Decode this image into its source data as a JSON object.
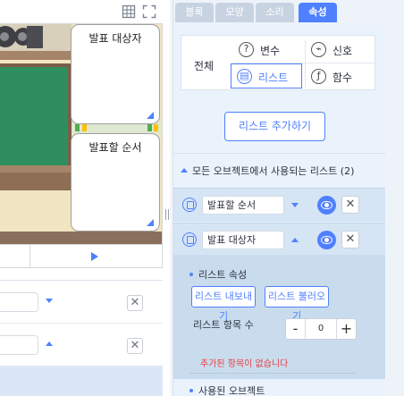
{
  "stage": {
    "toolbar": {
      "grid_icon": "grid-icon",
      "fullscreen_icon": "fullscreen-icon"
    },
    "list_cards": [
      {
        "title": "발표 대상자"
      },
      {
        "title": "발표할 순서"
      }
    ],
    "play_icon": "play-icon"
  },
  "object_panel": {
    "rows": [
      {
        "caret": "down"
      },
      {
        "caret": "up"
      }
    ],
    "close_glyph": "✕"
  },
  "tabs": [
    {
      "label": "블록",
      "active": false
    },
    {
      "label": "모양",
      "active": false
    },
    {
      "label": "소리",
      "active": false
    },
    {
      "label": "속성",
      "active": true
    }
  ],
  "var_types": {
    "all_label": "전체",
    "items": [
      {
        "label": "변수",
        "icon": "?",
        "selected": false
      },
      {
        "label": "신호",
        "icon": "⌁",
        "selected": false
      },
      {
        "label": "리스트",
        "icon": "▤",
        "selected": true
      },
      {
        "label": "함수",
        "icon": "ƒ",
        "selected": false
      }
    ]
  },
  "add_list_button": "리스트 추가하기",
  "section": {
    "title": "모든 오브젝트에서 사용되는 리스트 (2)"
  },
  "lists": [
    {
      "name": "발표할 순서",
      "expanded": false
    },
    {
      "name": "발표 대상자",
      "expanded": true
    }
  ],
  "list_props": {
    "title": "리스트 속성",
    "export_button": "리스트 내보내기",
    "import_button": "리스트 불러오기",
    "count_label": "리스트 항목 수",
    "count_value": "0",
    "minus": "-",
    "plus": "+",
    "empty_message": "추가된 항목이 없습니다",
    "used_objects_title": "사용된 오브젝트"
  },
  "colors": {
    "accent": "#4f80ff",
    "tab_inactive": "#c8d3e2",
    "error": "#ee3d3d"
  }
}
